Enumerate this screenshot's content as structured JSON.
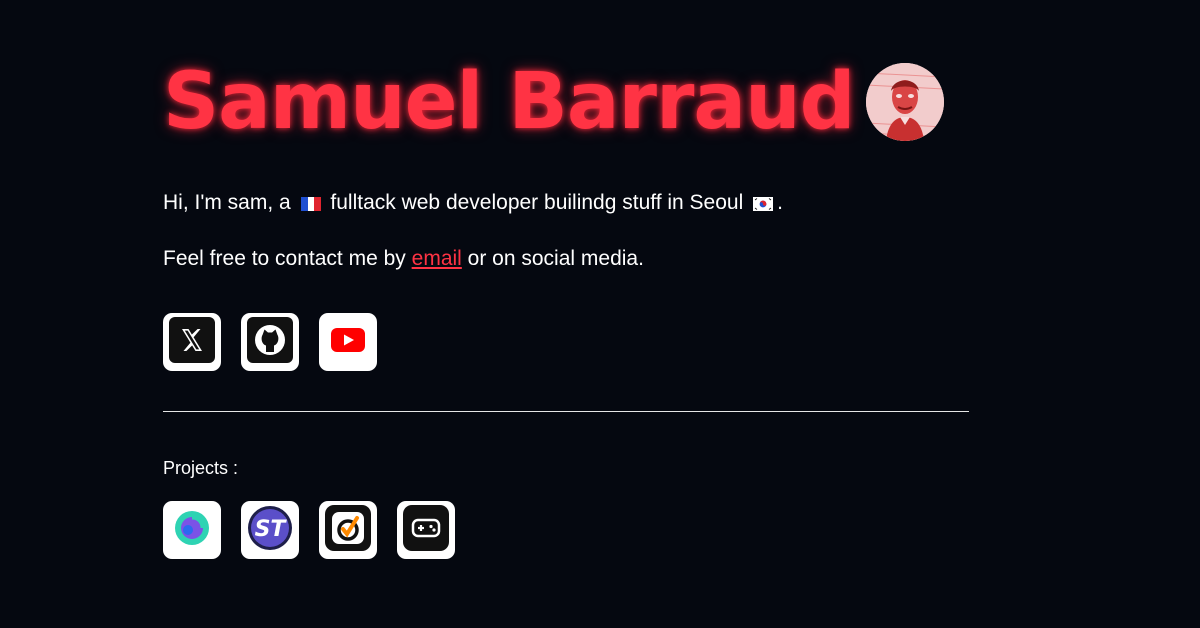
{
  "header": {
    "name": "Samuel Barraud"
  },
  "intro": {
    "before_flag": "Hi, I'm sam, a",
    "middle": "fulltack web developer builindg stuff in Seoul",
    "end": "."
  },
  "contact": {
    "before_link": "Feel free to contact me by",
    "link_label": "email",
    "after_link": "or on social media."
  },
  "social": [
    {
      "icon": "x-icon"
    },
    {
      "icon": "github-icon"
    },
    {
      "icon": "youtube-icon"
    }
  ],
  "projects": {
    "label": "Projects :",
    "items": [
      {
        "icon": "project-logo-icon"
      },
      {
        "icon": "st-logo-icon"
      },
      {
        "icon": "checkmark-logo-icon"
      },
      {
        "icon": "gamepad-icon"
      }
    ]
  },
  "colors": {
    "background": "#050810",
    "accent": "#ff3344",
    "text": "#ffffff"
  }
}
